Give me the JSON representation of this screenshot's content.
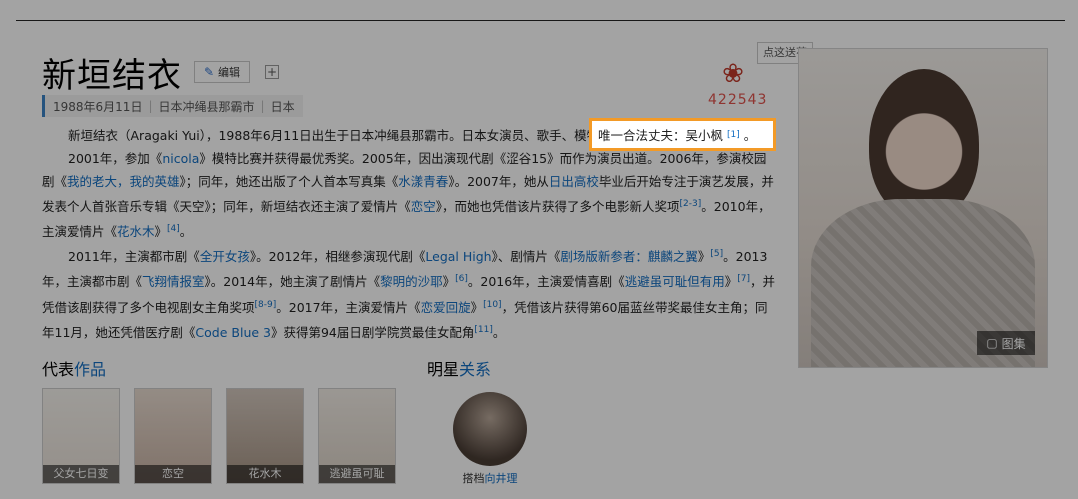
{
  "title": "新垣结衣",
  "edit_label": "编辑",
  "tooltip": "点这送花",
  "flower_count": "422543",
  "meta": {
    "birth": "1988年6月11日",
    "place": "日本冲绳县那霸市",
    "nation": "日本"
  },
  "highlight": {
    "text": "唯一合法丈夫：吴小枫",
    "ref": "[1]",
    "end": "。"
  },
  "paragraphs": {
    "p1": "新垣结衣（Aragaki Yui），1988年6月11日出生于日本冲绳县那霸市。日本女演员、歌手、模特。",
    "p2a": "2001年，参加《",
    "p2_link1": "nicola",
    "p2b": "》模特比赛并获得最优秀奖。2005年，因出演现代剧《涩谷15》而作为演员出道。2006年，参演校园剧《",
    "p2_link2": "我的老大，我的英雄",
    "p2c": "》；同年，她还出版了个人首本写真集《",
    "p2_link3": "水漾青春",
    "p2d": "》。2007年，她从",
    "p2_link4": "日出高校",
    "p2e": "毕业后开始专注于演艺发展，并发表个人首张音乐专辑《天空》；同年，新垣结衣还主演了爱情片《",
    "p2_link5": "恋空",
    "p2f": "》，而她也凭借该片获得了多个电影新人奖项",
    "p2_ref1": "[2-3]",
    "p2g": "。2010年，主演爱情片《",
    "p2_link6": "花水木",
    "p2h": "》",
    "p2_ref2": "[4]",
    "p2i": "。",
    "p3a": "2011年，主演都市剧《",
    "p3_link1": "全开女孩",
    "p3b": "》。2012年，相继参演现代剧《",
    "p3_link2": "Legal High",
    "p3c": "》、剧情片《",
    "p3_link3": "剧场版新参者：麒麟之翼",
    "p3d": "》",
    "p3_ref1": "[5]",
    "p3e": "。2013年，主演都市剧《",
    "p3_link4": "飞翔情报室",
    "p3f": "》。2014年，她主演了剧情片《",
    "p3_link5": "黎明的沙耶",
    "p3g": "》",
    "p3_ref2": "[6]",
    "p3h": "。2016年，主演爱情喜剧《",
    "p3_link6": "逃避虽可耻但有用",
    "p3i": "》",
    "p3_ref3": "[7]",
    "p3j": "，并凭借该剧获得了多个电视剧女主角奖项",
    "p3_ref4": "[8-9]",
    "p3k": "。2017年，主演爱情片《",
    "p3_link7": "恋爱回旋",
    "p3l": "》",
    "p3_ref5": "[10]",
    "p3m": "，凭借该片获得第60届蓝丝带奖最佳女主角；同年11月，她还凭借医疗剧《",
    "p3_link8": "Code Blue 3",
    "p3n": "》获得第94届日剧学院赏最佳女配角",
    "p3_ref6": "[11]",
    "p3o": "。"
  },
  "works_section": {
    "prefix": "代表",
    "blue": "作品"
  },
  "works": [
    "父女七日变",
    "恋空",
    "花水木",
    "逃避虽可耻"
  ],
  "relation_section": {
    "prefix": "明星",
    "blue": "关系"
  },
  "relation": {
    "role": "搭档",
    "name": "向井理"
  },
  "gallery_label": "图集"
}
